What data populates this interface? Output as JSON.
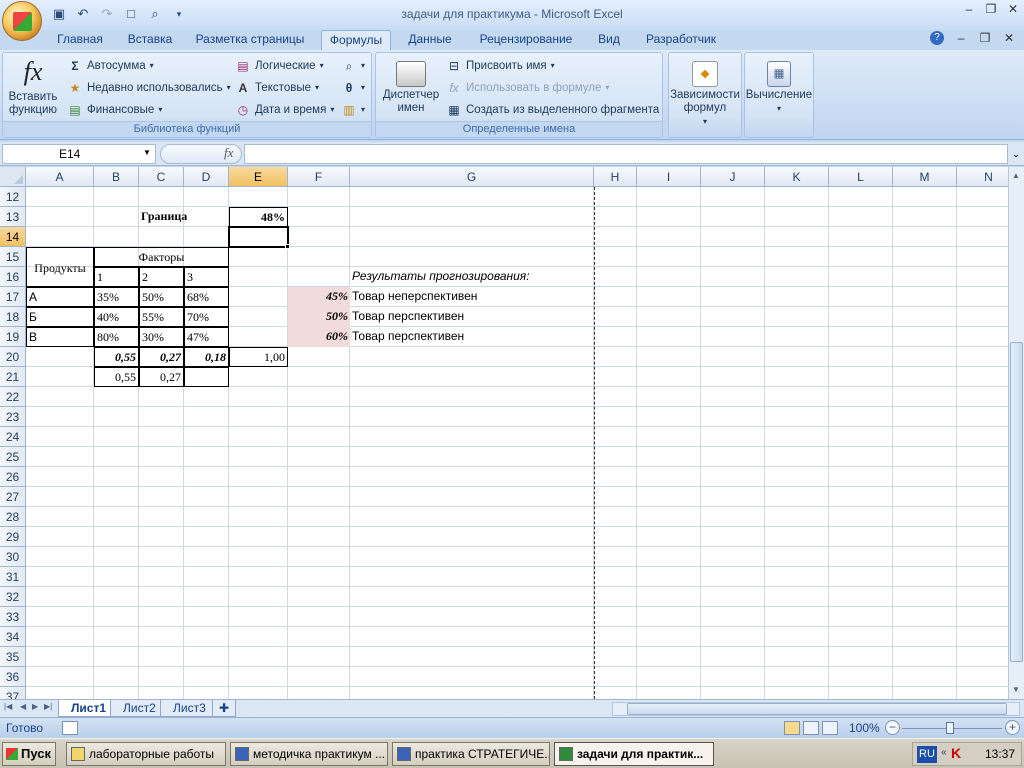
{
  "window": {
    "title": "задачи для практикума - Microsoft Excel"
  },
  "ribbon": {
    "tabs": [
      "Главная",
      "Вставка",
      "Разметка страницы",
      "Формулы",
      "Данные",
      "Рецензирование",
      "Вид",
      "Разработчик"
    ],
    "active_tab": "Формулы",
    "function_library": {
      "label": "Библиотека функций",
      "insert_function": "Вставить функцию",
      "autosum": "Автосумма",
      "recent": "Недавно использовались",
      "financial": "Финансовые",
      "logical": "Логические",
      "text": "Текстовые",
      "datetime": "Дата и время"
    },
    "defined_names": {
      "label": "Определенные имена",
      "name_manager": "Диспетчер имен",
      "define_name": "Присвоить имя",
      "use_in_formula": "Использовать в формуле",
      "create_from_selection": "Создать из выделенного фрагмента"
    },
    "formula_auditing": "Зависимости формул",
    "calculation": "Вычисление"
  },
  "formula_bar": {
    "name_box": "E14",
    "fx": "fx",
    "content": ""
  },
  "grid": {
    "columns": [
      "A",
      "B",
      "C",
      "D",
      "E",
      "F",
      "G",
      "H",
      "I",
      "J",
      "K",
      "L",
      "M",
      "N"
    ],
    "selected_column": "E",
    "rows": [
      "12",
      "13",
      "14",
      "15",
      "16",
      "17",
      "18",
      "19",
      "20",
      "21",
      "22",
      "23",
      "24",
      "25",
      "26",
      "27",
      "28",
      "29",
      "30",
      "31",
      "32",
      "33",
      "34",
      "35",
      "36",
      "37"
    ],
    "selected_row": "14",
    "cells": {
      "C13": "Граница",
      "E13": "48%",
      "A15": "Продукты",
      "C15": "Факторы",
      "B16": "1",
      "C16": "2",
      "D16": "3",
      "G16": "Результаты прогнозирования:",
      "A17": "А",
      "B17": "35%",
      "C17": "50%",
      "D17": "68%",
      "F17": "45%",
      "G17": "Товар неперспективен",
      "A18": "Б",
      "B18": "40%",
      "C18": "55%",
      "D18": "70%",
      "F18": "50%",
      "G18": "Товар перспективен",
      "A19": "В",
      "B19": "80%",
      "C19": "30%",
      "D19": "47%",
      "F19": "60%",
      "G19": "Товар перспективен",
      "B20": "0,55",
      "C20": "0,27",
      "D20": "0,18",
      "E20": "1,00",
      "B21": "0,55",
      "C21": "0,27"
    }
  },
  "sheets": {
    "tabs": [
      "Лист1",
      "Лист2",
      "Лист3"
    ],
    "active": "Лист1"
  },
  "status": {
    "text": "Готово",
    "zoom": "100%"
  },
  "taskbar": {
    "start": "Пуск",
    "items": [
      "лабораторные работы",
      "методичка практикум ...",
      "практика СТРАТЕГИЧЕ...",
      "задачи для практик..."
    ],
    "lang": "RU",
    "clock": "13:37"
  },
  "colors": {
    "highlight_fill": "#f2dcdb",
    "selection_header": "#f1c15f",
    "ribbon_text": "#15428b"
  }
}
